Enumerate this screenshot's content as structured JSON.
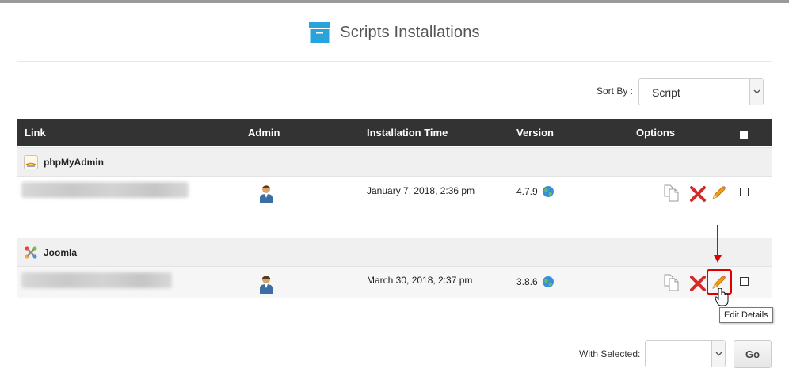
{
  "header": {
    "title": "Scripts Installations",
    "icon": "box-icon"
  },
  "sort": {
    "label": "Sort By :",
    "value": "Script"
  },
  "table": {
    "columns": [
      "Link",
      "Admin",
      "Installation Time",
      "Version",
      "Options"
    ]
  },
  "groups": [
    {
      "name": "phpMyAdmin",
      "installations": [
        {
          "time": "January 7, 2018, 2:36 pm",
          "version": "4.7.9"
        }
      ]
    },
    {
      "name": "Joomla",
      "installations": [
        {
          "time": "March 30, 2018, 2:37 pm",
          "version": "3.8.6"
        }
      ]
    }
  ],
  "tooltip": {
    "text": "Edit Details"
  },
  "footer": {
    "with_selected_label": "With Selected:",
    "with_selected_value": "---",
    "go_label": "Go"
  },
  "colors": {
    "header_bg": "#333333",
    "group_bg": "#f0f0f0",
    "accent_blue": "#29a3dc",
    "delete_red": "#d42a2a",
    "edit_orange": "#f39c12",
    "highlight_red": "#e00000"
  }
}
